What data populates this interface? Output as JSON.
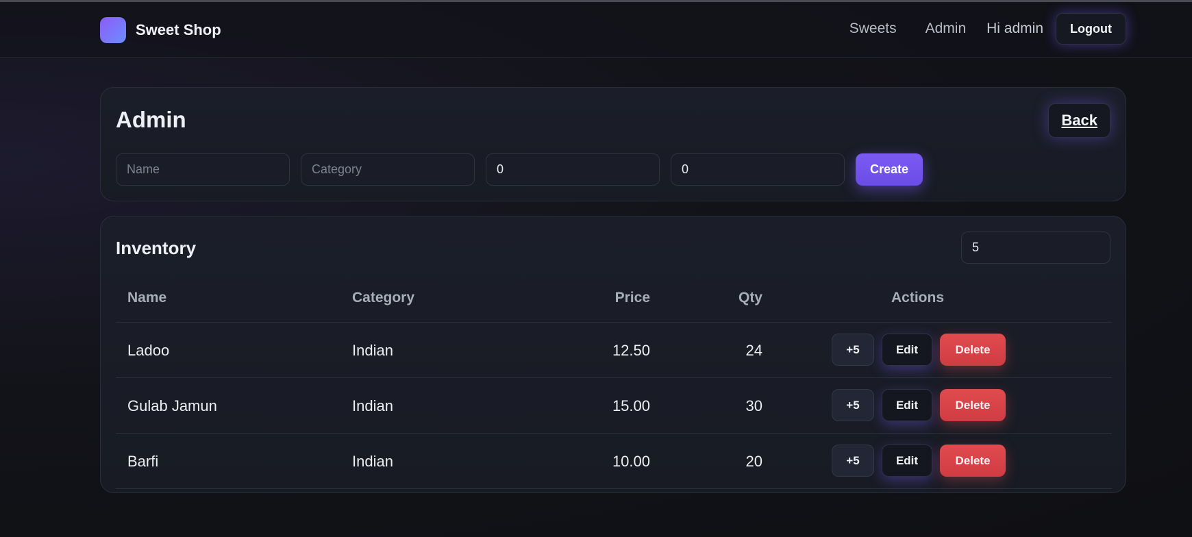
{
  "nav": {
    "brand": "Sweet Shop",
    "links": [
      "Sweets",
      "Admin"
    ],
    "greeting": "Hi admin",
    "logout_label": "Logout"
  },
  "admin": {
    "title": "Admin",
    "back_label": "Back",
    "form": {
      "name_placeholder": "Name",
      "category_placeholder": "Category",
      "price_value": "0",
      "qty_value": "0",
      "create_label": "Create"
    }
  },
  "inventory": {
    "title": "Inventory",
    "restock_amount": "5",
    "columns": [
      "Name",
      "Category",
      "Price",
      "Qty",
      "Actions"
    ],
    "rows": [
      {
        "name": "Ladoo",
        "category": "Indian",
        "price": "12.50",
        "qty": "24"
      },
      {
        "name": "Gulab Jamun",
        "category": "Indian",
        "price": "15.00",
        "qty": "30"
      },
      {
        "name": "Barfi",
        "category": "Indian",
        "price": "10.00",
        "qty": "20"
      }
    ],
    "actions": {
      "restock": "+5",
      "edit": "Edit",
      "delete": "Delete"
    }
  },
  "colors": {
    "accent": "#7b5bf2",
    "danger": "#e04b4f",
    "background": "#121318"
  }
}
